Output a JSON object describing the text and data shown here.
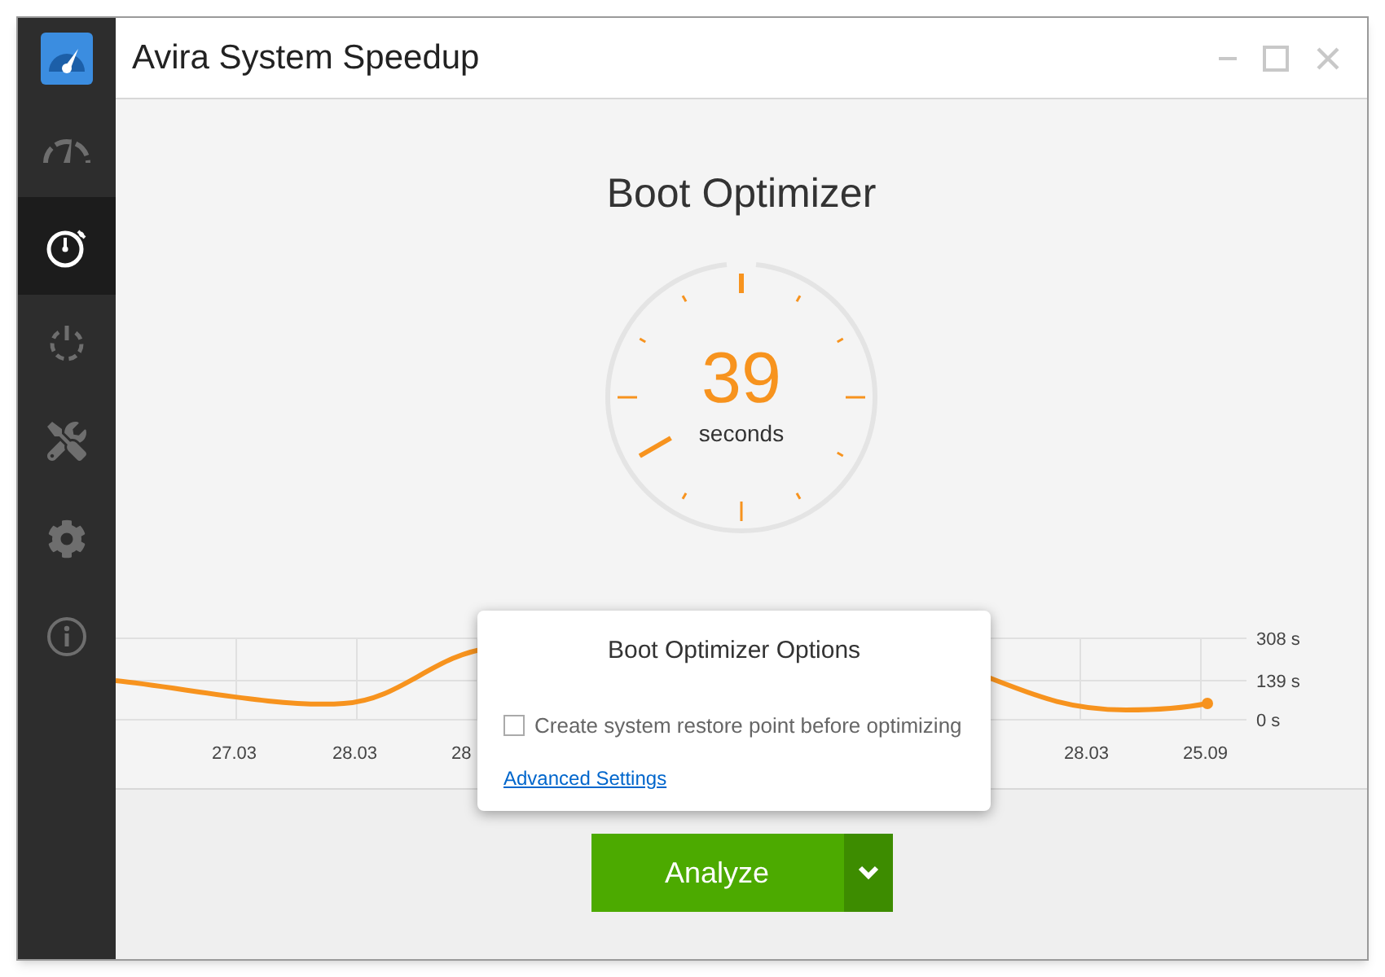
{
  "window": {
    "title": "Avira System Speedup"
  },
  "sidebar": {
    "items": [
      {
        "kind": "speedometer",
        "selected": false
      },
      {
        "kind": "stopwatch",
        "selected": true
      },
      {
        "kind": "power",
        "selected": false
      },
      {
        "kind": "tools",
        "selected": false
      },
      {
        "kind": "settings",
        "selected": false
      },
      {
        "kind": "info",
        "selected": false
      }
    ]
  },
  "page": {
    "title": "Boot Optimizer",
    "boot_time": {
      "value": "39",
      "unit": "seconds"
    },
    "history": {
      "x_labels": [
        "27.03",
        "28.03",
        "28",
        "28.03",
        "25.09"
      ],
      "y_labels": [
        "308 s",
        "139 s",
        "0 s"
      ]
    },
    "options_popup": {
      "title": "Boot Optimizer Options",
      "checkbox": {
        "label": "Create system restore point before optimizing",
        "checked": false
      },
      "link": "Advanced Settings"
    },
    "analyze_button": {
      "label": "Analyze"
    }
  }
}
